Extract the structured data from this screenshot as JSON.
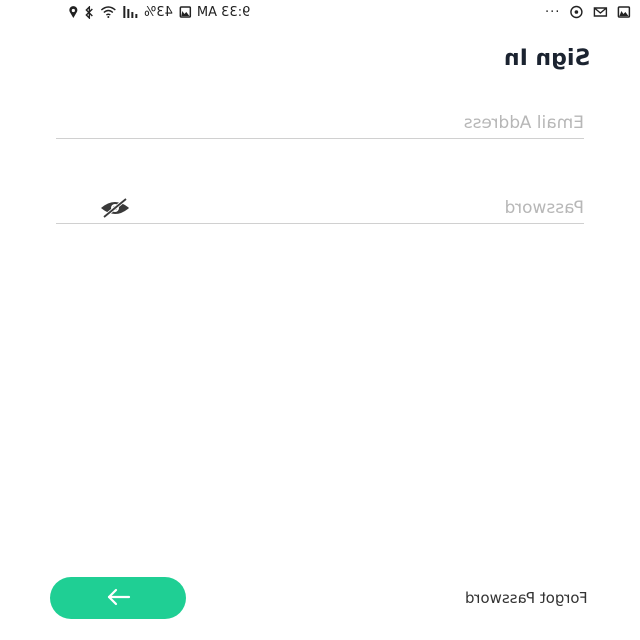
{
  "status_bar": {
    "time": "9:33 AM",
    "battery": "43%",
    "right_dots": "···"
  },
  "screen": {
    "title": "Sign In"
  },
  "form": {
    "email": {
      "placeholder": "Email Address",
      "value": ""
    },
    "password": {
      "placeholder": "Password",
      "value": ""
    }
  },
  "footer": {
    "forgot_password_label": "Forgot Password",
    "next_button_icon": "arrow-left-icon"
  },
  "colors": {
    "accent": "#1fcf94",
    "title": "#1b2330",
    "placeholder": "#b7b7b7",
    "divider": "#d0d0d0"
  }
}
